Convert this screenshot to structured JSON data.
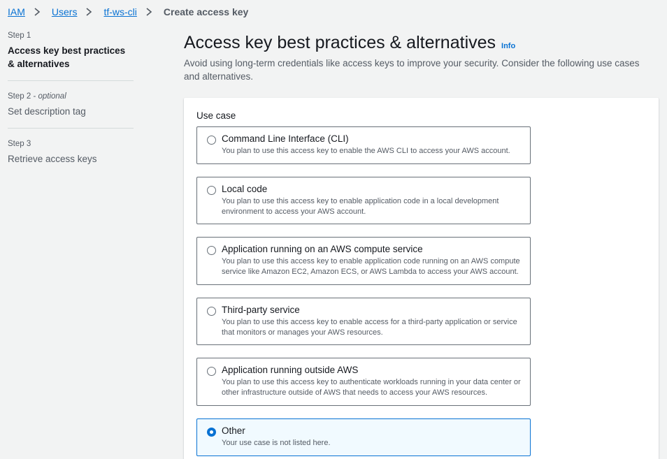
{
  "breadcrumb": {
    "items": [
      "IAM",
      "Users",
      "tf-ws-cli"
    ],
    "current": "Create access key"
  },
  "steps": [
    {
      "num": "Step 1",
      "optional": "",
      "title": "Access key best practices & alternatives"
    },
    {
      "num": "Step 2 - ",
      "optional": "optional",
      "title": "Set description tag"
    },
    {
      "num": "Step 3",
      "optional": "",
      "title": "Retrieve access keys"
    }
  ],
  "header": {
    "title": "Access key best practices & alternatives",
    "info": "Info",
    "description": "Avoid using long-term credentials like access keys to improve your security. Consider the following use cases and alternatives."
  },
  "use_case": {
    "label": "Use case",
    "selected": "Other",
    "options": [
      {
        "title": "Command Line Interface (CLI)",
        "desc": "You plan to use this access key to enable the AWS CLI to access your AWS account."
      },
      {
        "title": "Local code",
        "desc": "You plan to use this access key to enable application code in a local development environment to access your AWS account."
      },
      {
        "title": "Application running on an AWS compute service",
        "desc": "You plan to use this access key to enable application code running on an AWS compute service like Amazon EC2, Amazon ECS, or AWS Lambda to access your AWS account."
      },
      {
        "title": "Third-party service",
        "desc": "You plan to use this access key to enable access for a third-party application or service that monitors or manages your AWS resources."
      },
      {
        "title": "Application running outside AWS",
        "desc": "You plan to use this access key to authenticate workloads running in your data center or other infrastructure outside of AWS that needs to access your AWS resources."
      },
      {
        "title": "Other",
        "desc": "Your use case is not listed here."
      }
    ]
  },
  "colors": {
    "link": "#0972d3",
    "selected_bg": "#f1faff"
  }
}
